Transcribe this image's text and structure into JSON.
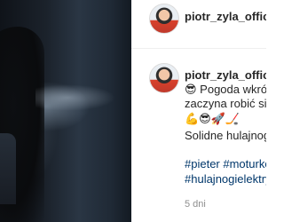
{
  "photo": {
    "alt": ""
  },
  "header": {
    "username": "piotr_zyla_official"
  },
  "comment": {
    "username": "piotr_zyla_official",
    "lines": [
      "😎 Pogoda wkrótce zaczyna robić się ładna",
      "zaczyna robić się ładna",
      "💪😎🚀🏒",
      "Solidne hulajnogi elektryczne"
    ],
    "hashtags": [
      "#pieter #moturkowo",
      "#hulajnogielektryczne"
    ],
    "timestamp": "5 dni"
  }
}
